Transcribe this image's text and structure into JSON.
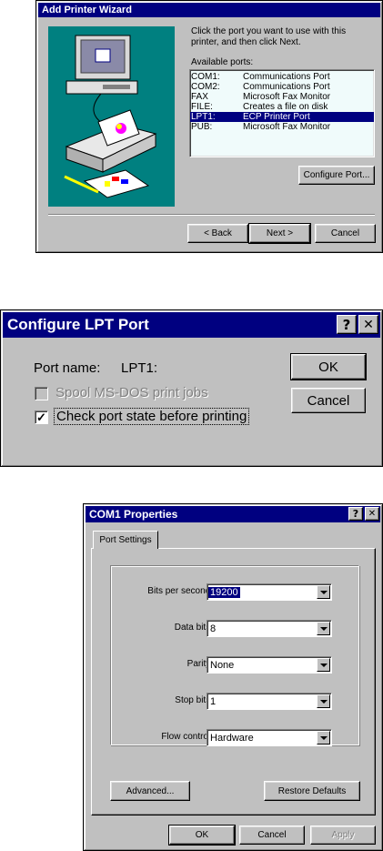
{
  "wizard": {
    "title": "Add Printer Wizard",
    "instruction": "Click the port you want to use with this printer, and then click Next.",
    "ports_label": "Available ports:",
    "ports": [
      {
        "name": "COM1:",
        "desc": "Communications Port"
      },
      {
        "name": "COM2:",
        "desc": "Communications Port"
      },
      {
        "name": "FAX",
        "desc": "Microsoft Fax Monitor"
      },
      {
        "name": "FILE:",
        "desc": "Creates a file on disk"
      },
      {
        "name": "LPT1:",
        "desc": "ECP Printer Port",
        "selected": true
      },
      {
        "name": "PUB:",
        "desc": "Microsoft Fax Monitor"
      }
    ],
    "configure_label": "Configure Port...",
    "back_label": "< Back",
    "next_label": "Next >",
    "cancel_label": "Cancel"
  },
  "lpt": {
    "title": "Configure LPT Port",
    "port_name_label": "Port name:",
    "port_name_value": "LPT1:",
    "spool_label": "Spool MS-DOS print jobs",
    "spool_checked": false,
    "spool_enabled": false,
    "check_label": "Check port state before printing",
    "check_checked": true,
    "ok_label": "OK",
    "cancel_label": "Cancel"
  },
  "com1": {
    "title": "COM1 Properties",
    "tab_label": "Port Settings",
    "fields": [
      {
        "label": "Bits per second:",
        "value": "19200"
      },
      {
        "label": "Data bits:",
        "value": "8"
      },
      {
        "label": "Parity:",
        "value": "None"
      },
      {
        "label": "Stop bits:",
        "value": "1"
      },
      {
        "label": "Flow control:",
        "value": "Hardware"
      }
    ],
    "advanced_label": "Advanced...",
    "restore_label": "Restore Defaults",
    "ok_label": "OK",
    "cancel_label": "Cancel",
    "apply_label": "Apply"
  },
  "icons": {
    "help": "?",
    "close": "✕",
    "check": "✓"
  },
  "colors": {
    "title_bar": "#000080",
    "face": "#c0c0c0",
    "wizard_art": "#008080"
  }
}
